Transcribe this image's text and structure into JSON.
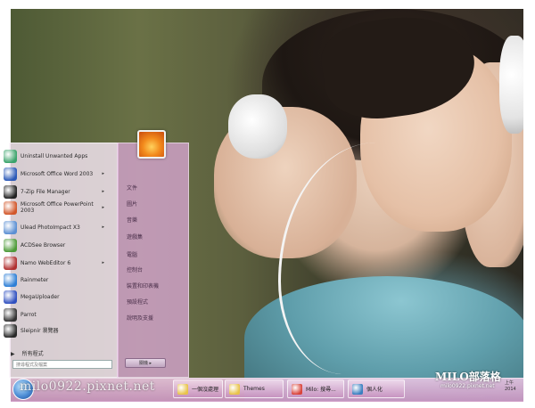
{
  "start_menu": {
    "programs": [
      {
        "label": "Uninstall Unwanted Apps",
        "icon": "uninstall-icon",
        "color": "#3aa36b",
        "submenu": false
      },
      {
        "label": "Microsoft Office Word 2003",
        "icon": "word-icon",
        "color": "#2b59b7",
        "submenu": true
      },
      {
        "label": "7-Zip File Manager",
        "icon": "7zip-icon",
        "color": "#222222",
        "submenu": true
      },
      {
        "label": "Microsoft Office PowerPoint 2003",
        "icon": "powerpoint-icon",
        "color": "#d2572a",
        "submenu": true
      },
      {
        "label": "Ulead PhotoImpact X3",
        "icon": "photoimpact-icon",
        "color": "#5b8fd3",
        "submenu": true
      },
      {
        "label": "ACDSee Browser",
        "icon": "acdsee-icon",
        "color": "#4c9a37",
        "submenu": false
      },
      {
        "label": "Namo WebEditor 6",
        "icon": "namo-icon",
        "color": "#b03030",
        "submenu": true
      },
      {
        "label": "Rainmeter",
        "icon": "rainmeter-icon",
        "color": "#2e7fd6",
        "submenu": false
      },
      {
        "label": "MegaUploader",
        "icon": "megauploader-icon",
        "color": "#3050c0",
        "submenu": false
      },
      {
        "label": "Parrot",
        "icon": "parrot-icon",
        "color": "#333333",
        "submenu": false
      },
      {
        "label": "Sleipnir 瀏覽器",
        "icon": "sleipnir-icon",
        "color": "#2a2a2a",
        "submenu": false
      }
    ],
    "all_programs": "所有程式",
    "search_placeholder": "搜尋程式及檔案",
    "places": [
      "文件",
      "圖片",
      "音樂",
      "遊戲集",
      "電腦",
      "控制台",
      "裝置和印表機",
      "預設程式",
      "說明及支援"
    ],
    "shutdown_label": "關機"
  },
  "taskbar": {
    "tasks": [
      {
        "label": "一個沒處理",
        "icon": "folder-icon",
        "color": "#e8c34a"
      },
      {
        "label": "Themes",
        "icon": "folder-icon",
        "color": "#e8c34a"
      },
      {
        "label": "Milo: 搜尋...",
        "icon": "chrome-icon",
        "color": "#d9443a"
      },
      {
        "label": "個人化",
        "icon": "personalize-icon",
        "color": "#3a7fc0"
      }
    ],
    "clock": "上午 2014"
  },
  "watermarks": {
    "left": "milo0922.pixnet.net",
    "right_brand": "MILO部落格",
    "right_url": "milo0922.pixnet.net"
  }
}
